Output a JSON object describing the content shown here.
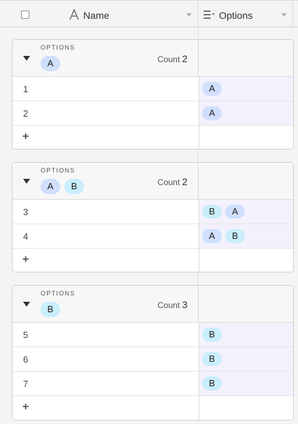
{
  "header": {
    "name_label": "Name",
    "options_label": "Options",
    "name_field_icon": "text-field-icon",
    "options_field_icon": "multiselect-field-icon"
  },
  "colors": {
    "pill_a": "#cfdffc",
    "pill_b": "#c9eefc",
    "options_cell_bg": "#f3f1fc"
  },
  "groups": [
    {
      "field_label": "OPTIONS",
      "pills": [
        "A"
      ],
      "count_label": "Count",
      "count": "2",
      "rows": [
        {
          "num": "1",
          "options": [
            "A"
          ]
        },
        {
          "num": "2",
          "options": [
            "A"
          ]
        }
      ],
      "add_label": "+"
    },
    {
      "field_label": "OPTIONS",
      "pills": [
        "A",
        "B"
      ],
      "count_label": "Count",
      "count": "2",
      "rows": [
        {
          "num": "3",
          "options": [
            "B",
            "A"
          ]
        },
        {
          "num": "4",
          "options": [
            "A",
            "B"
          ]
        }
      ],
      "add_label": "+"
    },
    {
      "field_label": "OPTIONS",
      "pills": [
        "B"
      ],
      "count_label": "Count",
      "count": "3",
      "rows": [
        {
          "num": "5",
          "options": [
            "B"
          ]
        },
        {
          "num": "6",
          "options": [
            "B"
          ]
        },
        {
          "num": "7",
          "options": [
            "B"
          ]
        }
      ],
      "add_label": "+"
    }
  ]
}
